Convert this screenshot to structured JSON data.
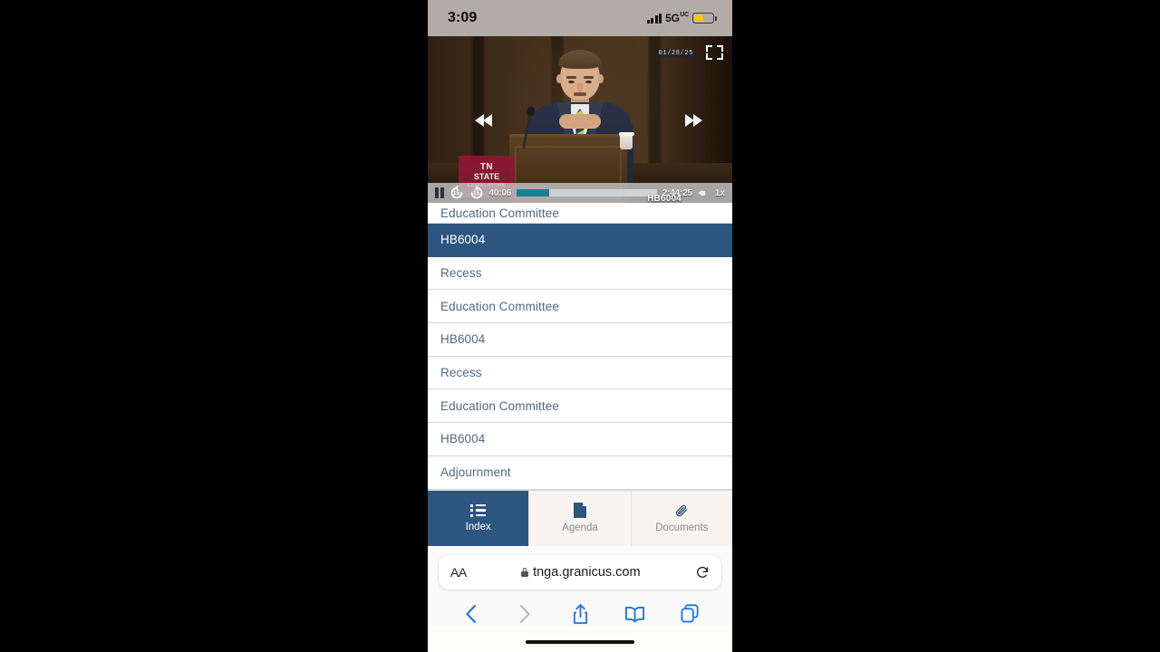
{
  "status_bar": {
    "time": "3:09",
    "network": "5G",
    "network_sub": "UC",
    "signal_icon": "signal-bars-icon",
    "battery_icon": "battery-low-power-icon"
  },
  "video": {
    "date_overlay": "01/28/25",
    "fullscreen_icon": "fullscreen-expand-icon",
    "rewind_icon": "rewind-icon",
    "forward_icon": "fast-forward-icon",
    "pause_icon": "pause-icon",
    "watermark_line1": "TN",
    "watermark_line2": "STATE",
    "watermark_line3": "LEGISLATURE",
    "skip_back_label": "15",
    "skip_forward_label": "15",
    "current_time": "40:06",
    "duration": "2:44:25",
    "speed": "1x",
    "volume_icon": "volume-icon",
    "progress_percent": 23,
    "caption": "HB6004",
    "accent_color": "#1b7f96"
  },
  "index_list": {
    "items": [
      {
        "label": "Education Committee",
        "selected": false,
        "clipped": true
      },
      {
        "label": "HB6004",
        "selected": true,
        "clipped": false
      },
      {
        "label": "Recess",
        "selected": false,
        "clipped": false
      },
      {
        "label": "Education Committee",
        "selected": false,
        "clipped": false
      },
      {
        "label": "HB6004",
        "selected": false,
        "clipped": false
      },
      {
        "label": "Recess",
        "selected": false,
        "clipped": false
      },
      {
        "label": "Education Committee",
        "selected": false,
        "clipped": false
      },
      {
        "label": "HB6004",
        "selected": false,
        "clipped": false
      },
      {
        "label": "Adjournment",
        "selected": false,
        "clipped": false
      }
    ],
    "selected_color": "#2c5580",
    "text_color": "#4b6b85"
  },
  "tab_bar": {
    "tabs": [
      {
        "label": "Index",
        "icon": "list-icon",
        "active": true
      },
      {
        "label": "Agenda",
        "icon": "document-icon",
        "active": false
      },
      {
        "label": "Documents",
        "icon": "paperclip-icon",
        "active": false
      }
    ]
  },
  "browser": {
    "text_size_label": "AA",
    "lock_icon": "lock-icon",
    "url": "tnga.granicus.com",
    "reload_icon": "reload-icon",
    "toolbar": [
      {
        "icon": "back-icon",
        "enabled": true
      },
      {
        "icon": "forward-icon",
        "enabled": false
      },
      {
        "icon": "share-icon",
        "enabled": true
      },
      {
        "icon": "bookmarks-icon",
        "enabled": true
      },
      {
        "icon": "tabs-icon",
        "enabled": true
      }
    ]
  }
}
